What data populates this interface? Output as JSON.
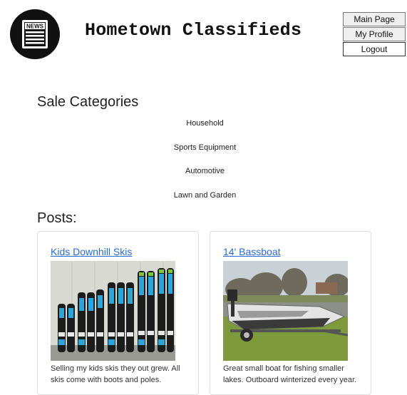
{
  "header": {
    "site_title": "Hometown Classifieds",
    "logo_text": "NEWS"
  },
  "nav": {
    "main_page": "Main Page",
    "my_profile": "My Profile",
    "logout": "Logout"
  },
  "categories": {
    "heading": "Sale Categories",
    "items": [
      "Household",
      "Sports Equipment",
      "Automotive",
      "Lawn and Garden"
    ]
  },
  "posts": {
    "heading": "Posts:",
    "items": [
      {
        "title": "Kids Downhill Skis",
        "description": "Selling my kids skis they out grew. All skis come with boots and poles."
      },
      {
        "title": "14' Bassboat",
        "description": "Great small boat for fishing smaller lakes. Outboard winterized every year."
      }
    ]
  }
}
